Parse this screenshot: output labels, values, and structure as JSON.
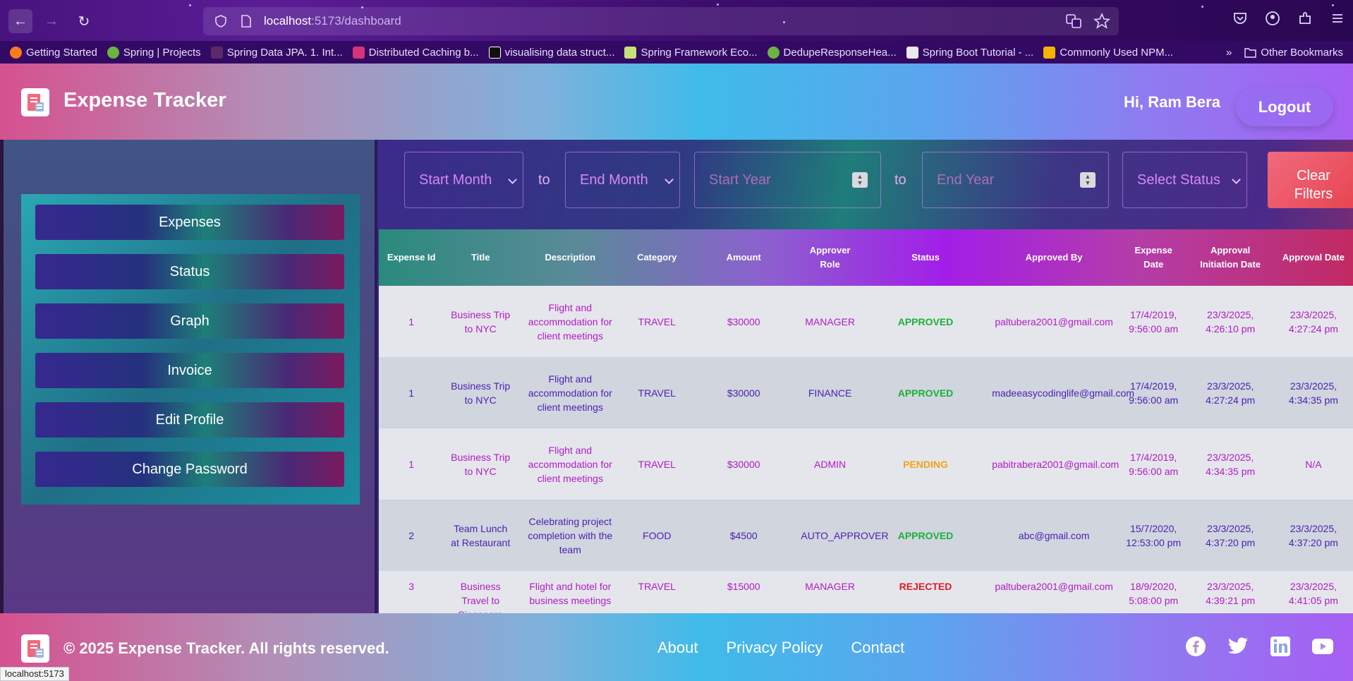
{
  "browser": {
    "url_host": "localhost",
    "url_path": ":5173/dashboard",
    "status_url": "localhost:5173",
    "bookmarks": [
      {
        "label": "Getting Started",
        "color": "#ff7a1a"
      },
      {
        "label": "Spring | Projects",
        "color": "#6db33f"
      },
      {
        "label": "Spring Data JPA. 1. Int...",
        "color": "#5a2a6a"
      },
      {
        "label": "Distributed Caching b...",
        "color": "#d6337a"
      },
      {
        "label": "visualising data struct...",
        "color": "#111111"
      },
      {
        "label": "Spring Framework Eco...",
        "color": "#c9e07a"
      },
      {
        "label": "DedupeResponseHea...",
        "color": "#6db33f"
      },
      {
        "label": "Spring Boot Tutorial - ...",
        "color": "#e9e9f0"
      },
      {
        "label": "Commonly Used NPM...",
        "color": "#f1b400"
      }
    ],
    "other_bookmarks": "Other Bookmarks"
  },
  "header": {
    "title": "Expense Tracker",
    "greeting": "Hi, Ram Bera",
    "logout_label": "Logout"
  },
  "sidebar": {
    "items": [
      "Expenses",
      "Status",
      "Graph",
      "Invoice",
      "Edit Profile",
      "Change Password"
    ]
  },
  "filters": {
    "start_month": "Start Month",
    "end_month": "End Month",
    "start_year_placeholder": "Start Year",
    "end_year_placeholder": "End Year",
    "select_status": "Select Status",
    "to1": "to",
    "to2": "to",
    "clear_line1": "Clear",
    "clear_line2": "Filters"
  },
  "table": {
    "headers": [
      "Expense Id",
      "Title",
      "Description",
      "Category",
      "Amount",
      "Approver Role",
      "Status",
      "Approved By",
      "Expense Date",
      "Approval Initiation Date",
      "Approval Date"
    ],
    "rows": [
      {
        "id": "1",
        "title": "Business Trip to NYC",
        "description": "Flight and accommodation for client meetings",
        "category": "TRAVEL",
        "amount": "$30000",
        "role": "MANAGER",
        "status": "APPROVED",
        "approved_by": "paltubera2001@gmail.com",
        "expense_date": "17/4/2019, 9:56:00 am",
        "initiation_date": "23/3/2025, 4:26:10 pm",
        "approval_date": "23/3/2025, 4:27:24 pm"
      },
      {
        "id": "1",
        "title": "Business Trip to NYC",
        "description": "Flight and accommodation for client meetings",
        "category": "TRAVEL",
        "amount": "$30000",
        "role": "FINANCE",
        "status": "APPROVED",
        "approved_by": "madeeasycodinglife@gmail.com",
        "expense_date": "17/4/2019, 9:56:00 am",
        "initiation_date": "23/3/2025, 4:27:24 pm",
        "approval_date": "23/3/2025, 4:34:35 pm"
      },
      {
        "id": "1",
        "title": "Business Trip to NYC",
        "description": "Flight and accommodation for client meetings",
        "category": "TRAVEL",
        "amount": "$30000",
        "role": "ADMIN",
        "status": "PENDING",
        "approved_by": "pabitrabera2001@gmail.com",
        "expense_date": "17/4/2019, 9:56:00 am",
        "initiation_date": "23/3/2025, 4:34:35 pm",
        "approval_date": "N/A"
      },
      {
        "id": "2",
        "title": "Team Lunch at Restaurant",
        "description": "Celebrating project completion with the team",
        "category": "FOOD",
        "amount": "$4500",
        "role": "AUTO_APPROVER",
        "status": "APPROVED",
        "approved_by": "abc@gmail.com",
        "expense_date": "15/7/2020, 12:53:00 pm",
        "initiation_date": "23/3/2025, 4:37:20 pm",
        "approval_date": "23/3/2025, 4:37:20 pm"
      },
      {
        "id": "3",
        "title": "Business Travel to Singapore",
        "description": "Flight and hotel for business meetings",
        "category": "TRAVEL",
        "amount": "$15000",
        "role": "MANAGER",
        "status": "REJECTED",
        "approved_by": "paltubera2001@gmail.com",
        "expense_date": "18/9/2020, 5:08:00 pm",
        "initiation_date": "23/3/2025, 4:39:21 pm",
        "approval_date": "23/3/2025, 4:41:05 pm"
      }
    ]
  },
  "footer": {
    "copyright": "© 2025 Expense Tracker. All rights reserved.",
    "links": [
      "About",
      "Privacy Policy",
      "Contact"
    ]
  }
}
